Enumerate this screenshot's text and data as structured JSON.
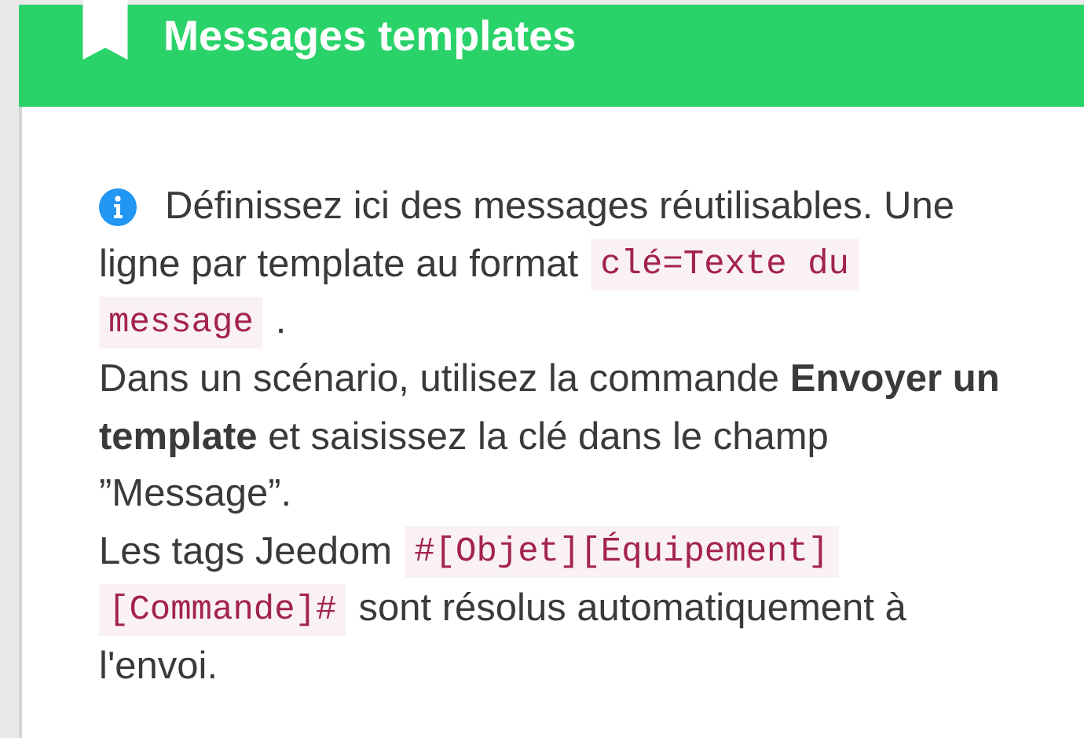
{
  "header": {
    "title": "Messages templates"
  },
  "lines": [
    {
      "info_icon": true,
      "segments": [
        {
          "kind": "text",
          "text": "Définissez ici des messages réutilisables. Une"
        }
      ]
    },
    {
      "info_icon": false,
      "segments": [
        {
          "kind": "text",
          "text": "ligne par template au format"
        },
        {
          "kind": "code",
          "text": "clé=Texte du"
        }
      ]
    },
    {
      "info_icon": false,
      "segments": [
        {
          "kind": "code",
          "text": "message"
        },
        {
          "kind": "text",
          "text": "."
        }
      ]
    },
    {
      "info_icon": false,
      "segments": [
        {
          "kind": "text",
          "text": "Dans un scénario, utilisez la commande **Envoyer un**"
        }
      ]
    },
    {
      "info_icon": false,
      "segments": [
        {
          "kind": "text",
          "text": "**template** et saisissez la clé dans le champ"
        }
      ]
    },
    {
      "info_icon": false,
      "segments": [
        {
          "kind": "text",
          "text": "”Message”."
        }
      ]
    },
    {
      "info_icon": false,
      "segments": [
        {
          "kind": "text",
          "text": "Les tags Jeedom"
        },
        {
          "kind": "code",
          "text": "#[Objet][Équipement]"
        }
      ]
    },
    {
      "info_icon": false,
      "segments": [
        {
          "kind": "code",
          "text": "[Commande]#"
        },
        {
          "kind": "text",
          "text": "sont résolus automatiquement à"
        }
      ]
    },
    {
      "info_icon": false,
      "segments": [
        {
          "kind": "text",
          "text": "l'envoi."
        }
      ]
    }
  ]
}
